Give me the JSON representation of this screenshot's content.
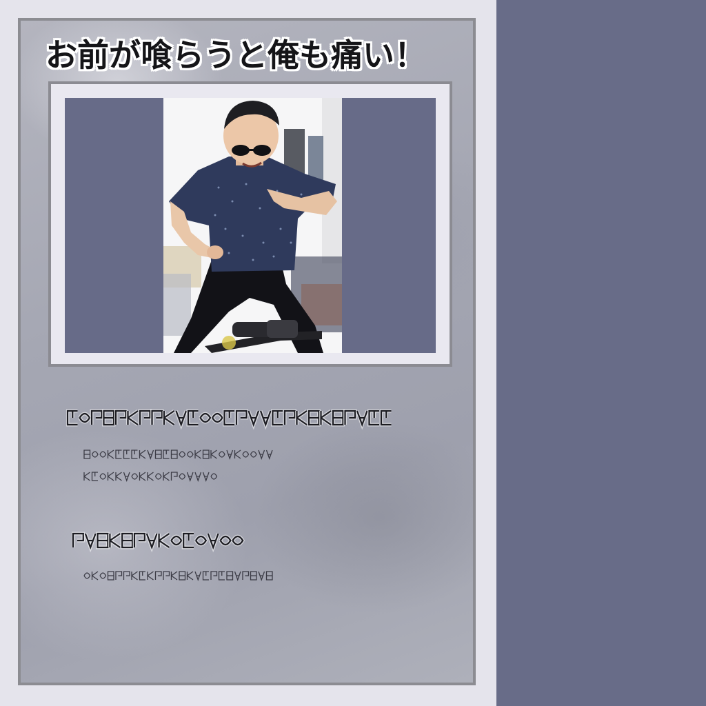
{
  "headline": "お前が喰らうと俺も痛い！",
  "colors": {
    "right_panel": "#686c88",
    "page_bg": "#e5e4ec",
    "card_border": "#8c8c92",
    "photo_letterbox": "#676b88",
    "shirt": "#2f3a5c",
    "pants": "#121217"
  },
  "photo": {
    "subject": "person-in-sunglasses-dancing"
  },
  "decorative_text_lines": [
    {
      "style": "heading",
      "name": "section-1-heading"
    },
    {
      "style": "body",
      "name": "section-1-line-1"
    },
    {
      "style": "body",
      "name": "section-1-line-2"
    },
    {
      "style": "heading",
      "name": "section-2-heading"
    },
    {
      "style": "body",
      "name": "section-2-line-1"
    }
  ]
}
